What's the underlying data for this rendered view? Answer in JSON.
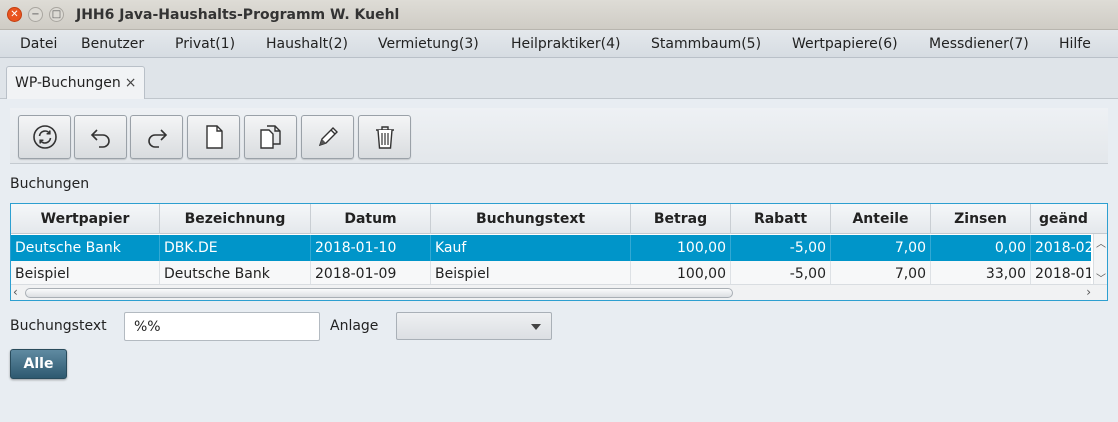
{
  "window": {
    "title": "JHH6 Java-Haushalts-Programm W. Kuehl",
    "controls": [
      "close-icon",
      "minimize-icon",
      "maximize-icon"
    ]
  },
  "menu": {
    "items": [
      "Datei",
      "Benutzer",
      "Privat(1)",
      "Haushalt(2)",
      "Vermietung(3)",
      "Heilpraktiker(4)",
      "Stammbaum(5)",
      "Wertpapiere(6)",
      "Messdiener(7)",
      "Hilfe"
    ]
  },
  "tabs": [
    {
      "label": "WP-Buchungen",
      "close": "×"
    }
  ],
  "toolbar": {
    "buttons": [
      "refresh-icon",
      "undo-icon",
      "redo-icon",
      "new-document-icon",
      "copy-document-icon",
      "edit-pencil-icon",
      "delete-trash-icon"
    ]
  },
  "section": {
    "label": "Buchungen"
  },
  "table": {
    "columns": [
      "Wertpapier",
      "Bezeichnung",
      "Datum",
      "Buchungstext",
      "Betrag",
      "Rabatt",
      "Anteile",
      "Zinsen",
      "geänd"
    ],
    "rows": [
      {
        "cells": [
          "Deutsche Bank",
          "DBK.DE",
          "2018-01-10",
          "Kauf",
          "100,00",
          "-5,00",
          "7,00",
          "0,00",
          "2018-02"
        ],
        "selected": true
      },
      {
        "cells": [
          "Beispiel",
          "Deutsche Bank",
          "2018-01-09",
          "Beispiel",
          "100,00",
          "-5,00",
          "7,00",
          "33,00",
          "2018-01"
        ],
        "selected": false
      }
    ]
  },
  "filter": {
    "buchungstext_label": "Buchungstext",
    "buchungstext_value": "%%",
    "anlage_label": "Anlage",
    "anlage_value": "",
    "all_button": "Alle"
  },
  "colors": {
    "selection": "#0095c9",
    "table_border": "#2d9fd0",
    "accent_button": "#3b677e"
  }
}
